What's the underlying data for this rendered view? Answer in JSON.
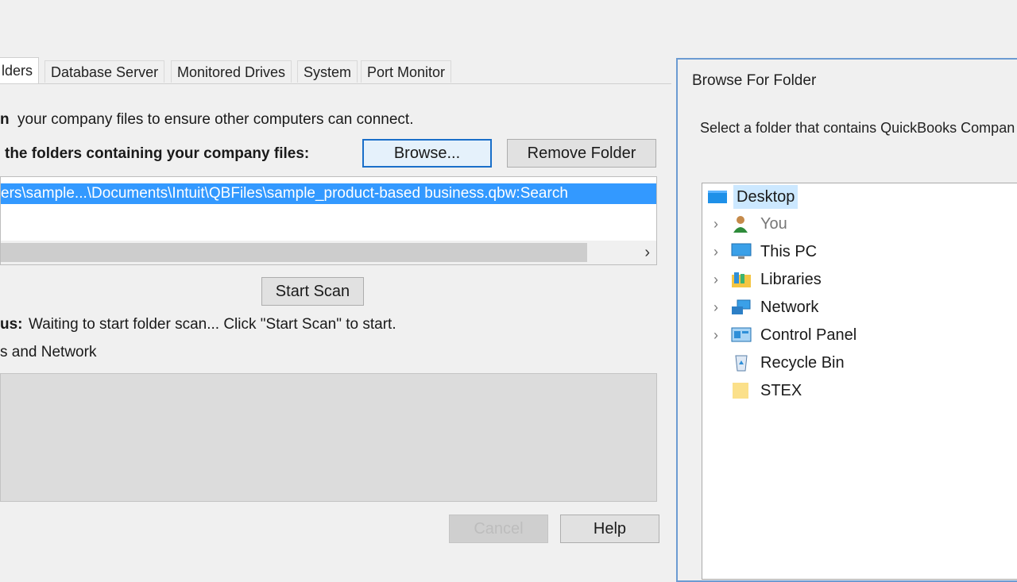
{
  "tabs": [
    "lders",
    "Database Server",
    "Monitored Drives",
    "System",
    "Port Monitor"
  ],
  "main": {
    "line1_bold": "n",
    "line1_text": "your company files to ensure other computers can connect.",
    "line2_label": "the folders containing your company files:",
    "browse_label": "Browse...",
    "remove_folder_label": "Remove Folder",
    "selected_path": "ers\\sample...\\Documents\\Intuit\\QBFiles\\sample_product-based business.qbw:Search",
    "scroll_right": "›",
    "start_scan_label": "Start Scan",
    "status_bold": "us:",
    "status_text": "Waiting to start folder scan...  Click \"Start Scan\" to start.",
    "section_text": "s and Network",
    "cancel_label": "Cancel",
    "help_label": "Help"
  },
  "dialog": {
    "title": "Browse For Folder",
    "instruction": "Select a folder that contains QuickBooks Compan",
    "tree": [
      {
        "label": "Desktop",
        "icon": "desktop-icon",
        "selected": true,
        "expandable": false
      },
      {
        "label": "You",
        "icon": "user-icon",
        "selected": false,
        "expandable": true
      },
      {
        "label": "This PC",
        "icon": "computer-icon",
        "selected": false,
        "expandable": true
      },
      {
        "label": "Libraries",
        "icon": "libraries-icon",
        "selected": false,
        "expandable": true
      },
      {
        "label": "Network",
        "icon": "network-icon",
        "selected": false,
        "expandable": true
      },
      {
        "label": "Control Panel",
        "icon": "control-panel-icon",
        "selected": false,
        "expandable": true
      },
      {
        "label": "Recycle Bin",
        "icon": "recycle-bin-icon",
        "selected": false,
        "expandable": false
      },
      {
        "label": "STEX",
        "icon": "folder-icon",
        "selected": false,
        "expandable": false
      }
    ]
  },
  "colors": {
    "selection": "#3399ff",
    "tree_selection": "#cce8ff",
    "focus_border": "#1a6fc9"
  }
}
